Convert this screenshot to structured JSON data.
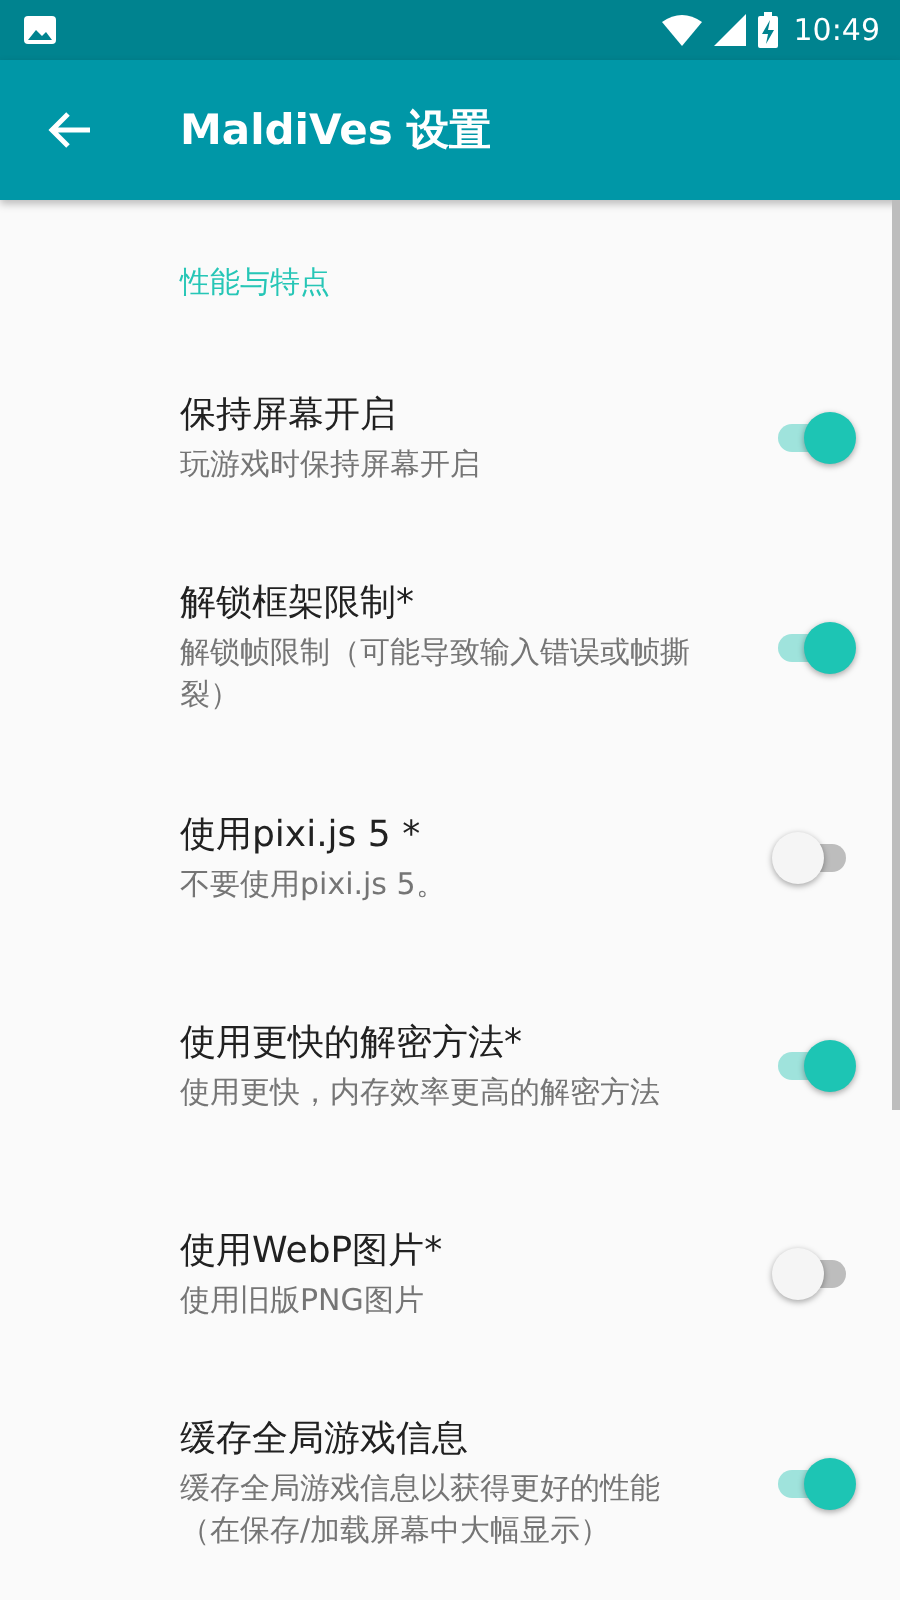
{
  "status_bar": {
    "time": "10:49"
  },
  "app_bar": {
    "title": "MaldiVes 设置"
  },
  "section": {
    "title": "性能与特点"
  },
  "settings": [
    {
      "title": "保持屏幕开启",
      "summary": "玩游戏时保持屏幕开启",
      "on": true
    },
    {
      "title": "解锁框架限制*",
      "summary": "解锁帧限制（可能导致输入错误或帧撕裂）",
      "on": true
    },
    {
      "title": "使用pixi.js 5 *",
      "summary": "不要使用pixi.js 5。",
      "on": false
    },
    {
      "title": "使用更快的解密方法*",
      "summary": "使用更快，内存效率更高的解密方法",
      "on": true
    },
    {
      "title": "使用WebP图片*",
      "summary": "使用旧版PNG图片",
      "on": false
    },
    {
      "title": "缓存全局游戏信息",
      "summary": "缓存全局游戏信息以获得更好的性能（在保存/加载屏幕中大幅显示）",
      "on": true
    }
  ]
}
